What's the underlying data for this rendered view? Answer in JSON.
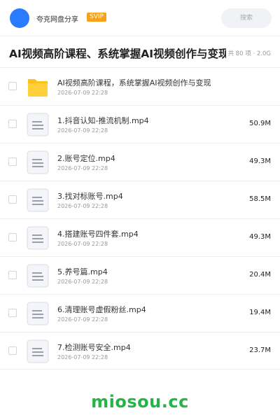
{
  "header": {
    "site_name": "夸克网盘分享",
    "badge": "SVIP",
    "search_placeholder": "搜索"
  },
  "page": {
    "title": "AI视频高阶课程、系统掌握AI视频创作与变现",
    "meta": "共 80 项 · 2.0G"
  },
  "files": [
    {
      "name": "AI视频高阶课程，系统掌握AI视频创作与变现",
      "date": "2026-07-09 22:28",
      "size": "",
      "type": "folder",
      "icon": "folder-icon"
    },
    {
      "name": "1.抖音认知-推流机制.mp4",
      "date": "2026-07-09 22:28",
      "size": "50.9M",
      "type": "file",
      "icon": "file-icon"
    },
    {
      "name": "2.账号定位.mp4",
      "date": "2026-07-09 22:28",
      "size": "49.3M",
      "type": "file",
      "icon": "file-icon"
    },
    {
      "name": "3.找对标账号.mp4",
      "date": "2026-07-09 22:28",
      "size": "58.5M",
      "type": "file",
      "icon": "file-icon"
    },
    {
      "name": "4.搭建账号四件套.mp4",
      "date": "2026-07-09 22:28",
      "size": "49.3M",
      "type": "file",
      "icon": "file-icon"
    },
    {
      "name": "5.养号篇.mp4",
      "date": "2026-07-09 22:28",
      "size": "20.4M",
      "type": "file",
      "icon": "file-icon"
    },
    {
      "name": "6.清理账号虚假粉丝.mp4",
      "date": "2026-07-09 22:28",
      "size": "19.4M",
      "type": "file",
      "icon": "file-icon"
    },
    {
      "name": "7.检测账号安全.mp4",
      "date": "2026-07-09 22:28",
      "size": "23.7M",
      "type": "file",
      "icon": "file-icon"
    }
  ],
  "footer": {
    "watermark": "miosou.cc"
  },
  "colors": {
    "accent": "#2b7bff",
    "badge": "#f7a21b",
    "folder": "#fcc21b",
    "watermark": "#25b546"
  }
}
